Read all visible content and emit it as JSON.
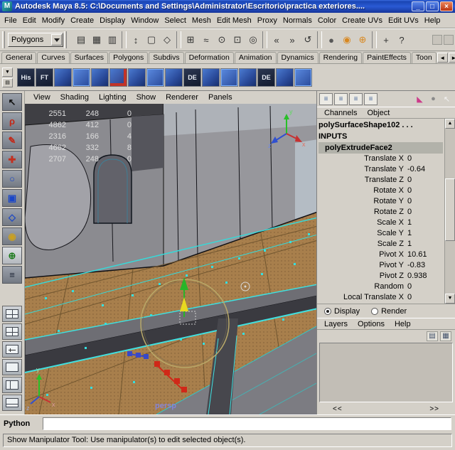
{
  "window": {
    "title": "Autodesk Maya 8.5: C:\\Documents and Settings\\Administrator\\Escritorio\\practica exteriores....",
    "app_icon_letter": "M",
    "buttons": [
      {
        "name": "minimize-button",
        "glyph": "_",
        "cls": "min"
      },
      {
        "name": "maximize-button",
        "glyph": "□",
        "cls": "max"
      },
      {
        "name": "close-button",
        "glyph": "×",
        "cls": "close"
      }
    ]
  },
  "menubar": {
    "items": [
      "File",
      "Edit",
      "Modify",
      "Create",
      "Display",
      "Window",
      "Select",
      "Mesh",
      "Edit Mesh",
      "Proxy",
      "Normals",
      "Color",
      "Create UVs",
      "Edit UVs",
      "Help"
    ]
  },
  "toolbar": {
    "menuset": "Polygons",
    "icons": [
      {
        "name": "new-scene-icon",
        "glyph": "▤"
      },
      {
        "name": "open-scene-icon",
        "glyph": "▦"
      },
      {
        "name": "save-scene-icon",
        "glyph": "▥"
      },
      {
        "name": "separator",
        "glyph": "",
        "cls": "sep"
      },
      {
        "name": "select-by-hierarchy-icon",
        "glyph": "↕"
      },
      {
        "name": "select-by-object-icon",
        "glyph": "▢"
      },
      {
        "name": "select-by-component-icon",
        "glyph": "◇"
      },
      {
        "name": "separator",
        "glyph": "",
        "cls": "sep"
      },
      {
        "name": "snap-to-grid-icon",
        "glyph": "⊞"
      },
      {
        "name": "snap-to-curve-icon",
        "glyph": "≈"
      },
      {
        "name": "snap-to-point-icon",
        "glyph": "⊙"
      },
      {
        "name": "snap-to-view-plane-icon",
        "glyph": "⊡"
      },
      {
        "name": "make-live-icon",
        "glyph": "◎"
      },
      {
        "name": "separator",
        "glyph": "",
        "cls": "sep"
      },
      {
        "name": "input-connections-icon",
        "glyph": "«"
      },
      {
        "name": "output-connections-icon",
        "glyph": "»"
      },
      {
        "name": "construction-history-icon",
        "glyph": "↺"
      },
      {
        "name": "separator",
        "glyph": "",
        "cls": "sep"
      },
      {
        "name": "render-current-frame-icon",
        "glyph": "●",
        "color": "#585858"
      },
      {
        "name": "ipr-render-icon",
        "glyph": "◉",
        "color": "#d88820"
      },
      {
        "name": "render-settings-icon",
        "glyph": "⊕",
        "color": "#d88820"
      },
      {
        "name": "separator",
        "glyph": "",
        "cls": "sep"
      },
      {
        "name": "plus-icon",
        "glyph": "+"
      },
      {
        "name": "help-icon",
        "glyph": "?"
      }
    ]
  },
  "shelf": {
    "tabs": [
      "General",
      "Curves",
      "Surfaces",
      "Polygons",
      "Subdivs",
      "Deformation",
      "Animation",
      "Dynamics",
      "Rendering",
      "PaintEffects",
      "Toon"
    ],
    "nav_prev": "◄",
    "nav_next": "►",
    "controls": [
      {
        "name": "shelf-tab-menu-icon",
        "glyph": "▼"
      },
      {
        "name": "shelf-editor-menu-icon",
        "glyph": "▤"
      }
    ],
    "icons": [
      {
        "label": "His",
        "cls": "dark"
      },
      {
        "label": "FT",
        "cls": "dark"
      },
      {
        "cls": "blue"
      },
      {
        "cls": "blue2"
      },
      {
        "cls": "blue"
      },
      {
        "cls": "blue3"
      },
      {
        "cls": "blue"
      },
      {
        "cls": "blue2"
      },
      {
        "cls": "blue"
      },
      {
        "label": "DE",
        "cls": "dark"
      },
      {
        "cls": "blue"
      },
      {
        "cls": "blue2"
      },
      {
        "cls": "blue"
      },
      {
        "label": "DE",
        "cls": "dark"
      },
      {
        "cls": "blue"
      },
      {
        "cls": "blue2"
      }
    ]
  },
  "toolbox": {
    "tools": [
      {
        "name": "select-tool",
        "glyph": "↖",
        "color": "#101010"
      },
      {
        "name": "lasso-tool",
        "glyph": "ρ",
        "color": "#c22818"
      },
      {
        "name": "paint-select-tool",
        "glyph": "✎",
        "color": "#c22818"
      },
      {
        "name": "move-tool",
        "glyph": "✚",
        "color": "#c23020"
      },
      {
        "name": "rotate-tool",
        "glyph": "○",
        "color": "#1a46c8"
      },
      {
        "name": "scale-tool",
        "glyph": "▣",
        "color": "#1a46c8"
      },
      {
        "name": "universal-manipulator-tool",
        "glyph": "◇",
        "color": "#1a46c8"
      },
      {
        "name": "soft-mod-tool",
        "glyph": "◉",
        "color": "#caa020"
      },
      {
        "name": "show-manipulator-tool",
        "glyph": "⊕",
        "color": "#1c7a1c",
        "cls": "active"
      },
      {
        "name": "last-tool",
        "glyph": "≡",
        "color": "#202838"
      }
    ]
  },
  "viewport": {
    "menu": [
      "View",
      "Shading",
      "Lighting",
      "Show",
      "Renderer",
      "Panels"
    ],
    "hud": [
      [
        "2551",
        "248",
        "0"
      ],
      [
        "4862",
        "412",
        "0"
      ],
      [
        "2316",
        "166",
        "4"
      ],
      [
        "4662",
        "332",
        "8"
      ],
      [
        "2707",
        "248",
        "0"
      ]
    ],
    "camera_label": "persp",
    "axis": {
      "x": "x",
      "y": "y",
      "z": "z"
    }
  },
  "right_panel": {
    "top_icons_left": [
      {
        "name": "layout-preset-icon-1",
        "glyph": "≡"
      },
      {
        "name": "layout-preset-icon-2",
        "glyph": "≡"
      },
      {
        "name": "layout-preset-icon-3",
        "glyph": "≡"
      },
      {
        "name": "layout-preset-icon-4",
        "glyph": "≡"
      }
    ],
    "top_icons_right": [
      {
        "name": "magenta-wedge-icon",
        "glyph": "◣",
        "color": "#cc3a8a"
      },
      {
        "name": "sphere-icon",
        "glyph": "●",
        "color": "#8a8a8a"
      },
      {
        "name": "cursor-icon",
        "glyph": "↖",
        "color": "#f4f4f4"
      }
    ]
  },
  "channel_box": {
    "menu": [
      "Channels",
      "Object"
    ],
    "shape_node": "polySurfaceShape102 . . .",
    "inputs_label": "INPUTS",
    "selected_node": "polyExtrudeFace2",
    "attributes": [
      {
        "name": "Translate X",
        "value": "0"
      },
      {
        "name": "Translate Y",
        "value": "-0.64"
      },
      {
        "name": "Translate Z",
        "value": "0"
      },
      {
        "name": "Rotate X",
        "value": "0"
      },
      {
        "name": "Rotate Y",
        "value": "0"
      },
      {
        "name": "Rotate Z",
        "value": "0"
      },
      {
        "name": "Scale X",
        "value": "1"
      },
      {
        "name": "Scale Y",
        "value": "1"
      },
      {
        "name": "Scale Z",
        "value": "1"
      },
      {
        "name": "Pivot X",
        "value": "10.61"
      },
      {
        "name": "Pivot Y",
        "value": "-0.83"
      },
      {
        "name": "Pivot Z",
        "value": "0.938"
      },
      {
        "name": "Random",
        "value": "0"
      },
      {
        "name": "Local Translate X",
        "value": "0"
      }
    ],
    "scroll_up": "▲",
    "scroll_down": "▼"
  },
  "layer_editor": {
    "display_label": "Display",
    "render_label": "Render",
    "menu": [
      "Layers",
      "Options",
      "Help"
    ],
    "icons": [
      {
        "name": "create-empty-layer-icon",
        "glyph": "▤"
      },
      {
        "name": "create-layer-from-selected-icon",
        "glyph": "▦"
      }
    ],
    "pager_prev": "<<",
    "pager_next": ">>"
  },
  "command_line": {
    "label": "Python",
    "value": ""
  },
  "help_line": {
    "text": "Show Manipulator Tool: Use manipulator(s) to edit selected object(s)."
  }
}
